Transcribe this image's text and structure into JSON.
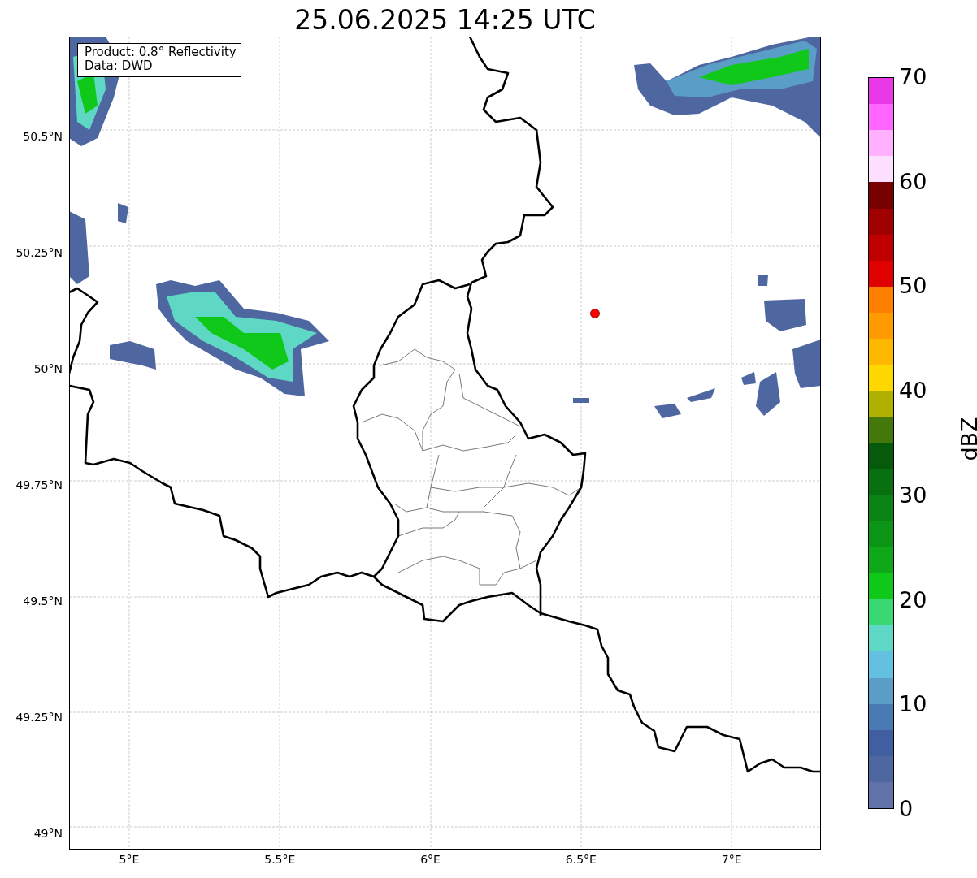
{
  "title": "25.06.2025 14:25 UTC",
  "info_box": [
    "Product: 0.8° Reflectivity",
    "Data: DWD"
  ],
  "y_ticks": [
    "50.5°N",
    "50.25°N",
    "50°N",
    "49.75°N",
    "49.5°N",
    "49.25°N",
    "49°N"
  ],
  "x_ticks": [
    "5°E",
    "5.5°E",
    "6°E",
    "6.5°E",
    "7°E"
  ],
  "colorbar": {
    "label": "dBZ",
    "ticks": [
      "70",
      "60",
      "50",
      "40",
      "30",
      "20",
      "10",
      "0"
    ],
    "bins": [
      {
        "color": "#e838e8"
      },
      {
        "color": "#ff66ff"
      },
      {
        "color": "#ffb0ff"
      },
      {
        "color": "#ffdfff"
      },
      {
        "color": "#780000"
      },
      {
        "color": "#a00000"
      },
      {
        "color": "#c00000"
      },
      {
        "color": "#e00000"
      },
      {
        "color": "#ff7f00"
      },
      {
        "color": "#ff9a00"
      },
      {
        "color": "#ffb800"
      },
      {
        "color": "#ffd700"
      },
      {
        "color": "#b0b000"
      },
      {
        "color": "#45780a"
      },
      {
        "color": "#065a0c"
      },
      {
        "color": "#087010"
      },
      {
        "color": "#0a8214"
      },
      {
        "color": "#0c9416"
      },
      {
        "color": "#0ea818"
      },
      {
        "color": "#10c81a"
      },
      {
        "color": "#3ad873"
      },
      {
        "color": "#5fd7c5"
      },
      {
        "color": "#64c0e0"
      },
      {
        "color": "#5a9ec8"
      },
      {
        "color": "#4a7ab3"
      },
      {
        "color": "#415ea0"
      },
      {
        "color": "#4f67a0"
      },
      {
        "color": "#6272a8"
      }
    ]
  }
}
